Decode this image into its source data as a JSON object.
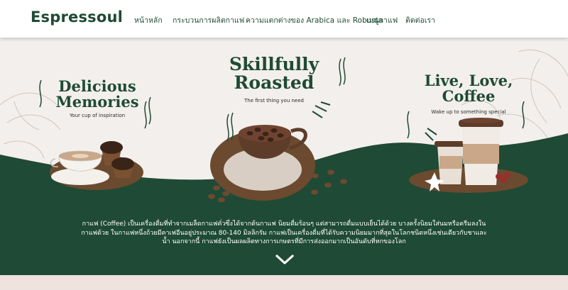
{
  "brand": {
    "logo": "Espressoul",
    "green": "#1f4a35",
    "brown": "#6b4a2f"
  },
  "nav": {
    "items": [
      {
        "label": "หน้าหลัก",
        "key": "home"
      },
      {
        "label": "กระบวนการผลิตกาแฟ",
        "key": "production"
      },
      {
        "label": "ความแตกต่างของ Arabica และ Robusta",
        "key": "differences"
      },
      {
        "label": "เมนูกาแฟ",
        "key": "menu"
      },
      {
        "label": "ติดต่อเรา",
        "key": "contact"
      }
    ]
  },
  "hero": {
    "panels": [
      {
        "title": "Delicious Memories",
        "subtitle": "Your cup of inspiration"
      },
      {
        "title": "Skillfully Roasted",
        "subtitle": "The first thing you need"
      },
      {
        "title": "Live, Love, Coffee",
        "subtitle": "Wake up to something special"
      }
    ],
    "description": "กาแฟ (Coffee) เป็นเครื่องดื่มที่ทำจากเมล็ดกาแฟคั่วซึ่งได้จากต้นกาแฟ นิยมดื่มร้อนๆ แต่สามารถดื่มแบบเย็นได้ด้วย บางครั้งนิยมใส่นมหรือครีมลงในกาแฟด้วย ในกาแฟหนึ่งถ้วยมีคาเฟอีนอยู่ประมาณ 80-140 มิลลิกรัม กาแฟเป็นเครื่องดื่มที่ได้รับความนิยมมากที่สุดในโลกชนิดหนึ่งเช่นเดียวกับชาและน้ำ นอกจากนี้ กาแฟยังเป็นผลผลิตทางการเกษตรที่มีการส่งออกมากเป็นอันดับที่หกของโลก",
    "scroll_icon": "chevron-down-icon"
  }
}
